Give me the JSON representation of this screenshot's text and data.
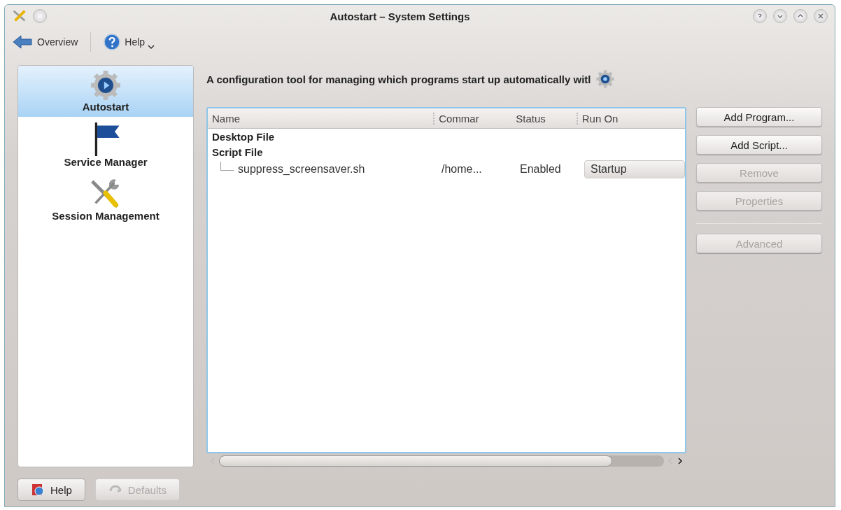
{
  "window": {
    "title": "Autostart – System Settings"
  },
  "toolbar": [
    {
      "kind": "back",
      "label": "Overview"
    },
    {
      "kind": "help",
      "label": "Help"
    }
  ],
  "sidebar": {
    "items": [
      {
        "kind": "gear",
        "label": "Autostart",
        "selected": true
      },
      {
        "kind": "flag",
        "label": "Service Manager",
        "selected": false
      },
      {
        "kind": "tools",
        "label": "Session Management",
        "selected": false
      }
    ]
  },
  "description": "A configuration tool for managing which programs start up automatically witl",
  "table": {
    "columns": [
      "Name",
      "Commar",
      "Status",
      "Run On"
    ],
    "groups": [
      {
        "label": "Desktop File"
      },
      {
        "label": "Script File",
        "children": [
          {
            "name": "suppress_screensaver.sh",
            "command": "/home...",
            "status": "Enabled",
            "run_on": "Startup"
          }
        ]
      }
    ]
  },
  "actions": [
    {
      "label": "Add Program...",
      "disabled": false
    },
    {
      "label": "Add Script...",
      "disabled": false
    },
    {
      "label": "Remove",
      "disabled": true
    },
    {
      "label": "Properties",
      "disabled": true
    },
    {
      "label": "Advanced",
      "disabled": true
    }
  ],
  "footer": [
    {
      "kind": "help",
      "label": "Help",
      "disabled": false
    },
    {
      "kind": "defaults",
      "label": "Defaults",
      "disabled": true
    }
  ]
}
